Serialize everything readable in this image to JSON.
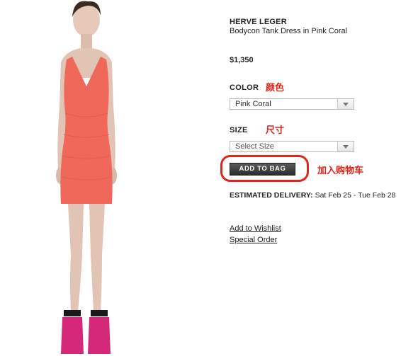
{
  "product": {
    "brand": "HERVE LEGER",
    "name": "Bodycon Tank Dress in Pink Coral",
    "price": "$1,350",
    "image": {
      "dress_color": "#f0685a",
      "shoe_strap_color": "#1a1a1a",
      "shoe_color": "#d5287a",
      "skin_color": "#e2c4b4"
    }
  },
  "color": {
    "label": "COLOR",
    "selected": "Pink Coral",
    "annotation": "颜色"
  },
  "size": {
    "label": "SIZE",
    "selected": "Select Size",
    "annotation": "尺寸"
  },
  "add_to_bag": {
    "label": "ADD TO BAG",
    "annotation": "加入购物车",
    "annotation_color": "#e0261b"
  },
  "delivery": {
    "label": "ESTIMATED DELIVERY:",
    "value": "Sat Feb 25 - Tue Feb 28"
  },
  "links": {
    "wishlist": "Add to Wishlist",
    "special_order": "Special Order"
  }
}
